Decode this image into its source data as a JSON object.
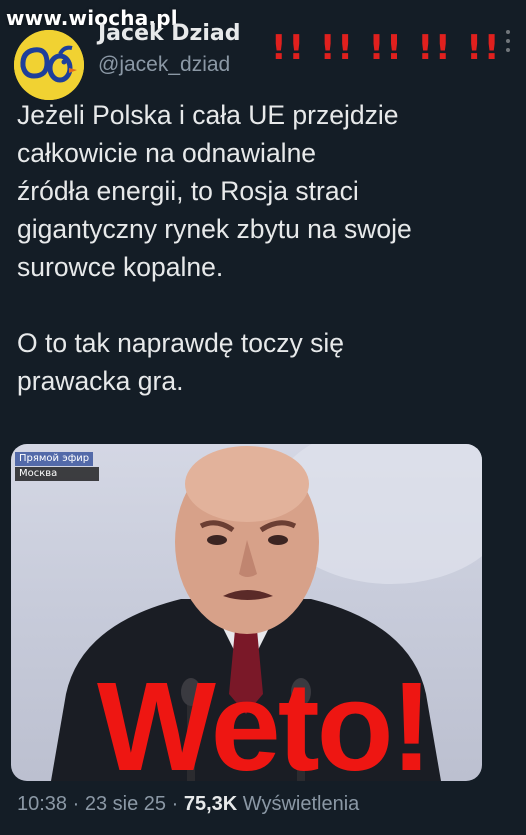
{
  "watermark": "www.wiocha.pl",
  "header": {
    "name": "Jacek Dziad",
    "handle": "@jacek_dziad",
    "marks": "!! !! !! !! !!"
  },
  "tweet": {
    "paragraphs": [
      "Jeżeli Polska i cała UE przejdzie\ncałkowicie na odnawialne\nźródła energii, to Rosja straci\ngigantyczny rynek zbytu na swoje\nsurowce kopalne.",
      "O to tak naprawdę toczy się\nprawacka gra."
    ]
  },
  "media": {
    "live_label": "Прямой эфир",
    "city_label": "Москва",
    "overlay_text": "Weto!"
  },
  "meta": {
    "time": "10:38",
    "date": "23 sie 25",
    "views_count": "75,3K",
    "views_label": "Wyświetlenia",
    "separator": "·"
  },
  "colors": {
    "background": "#141d26",
    "text": "#e7e9ea",
    "muted": "#8b98a5",
    "marks": "#e0201e",
    "overlay": "#ee1612",
    "avatar": "#f1d232"
  }
}
